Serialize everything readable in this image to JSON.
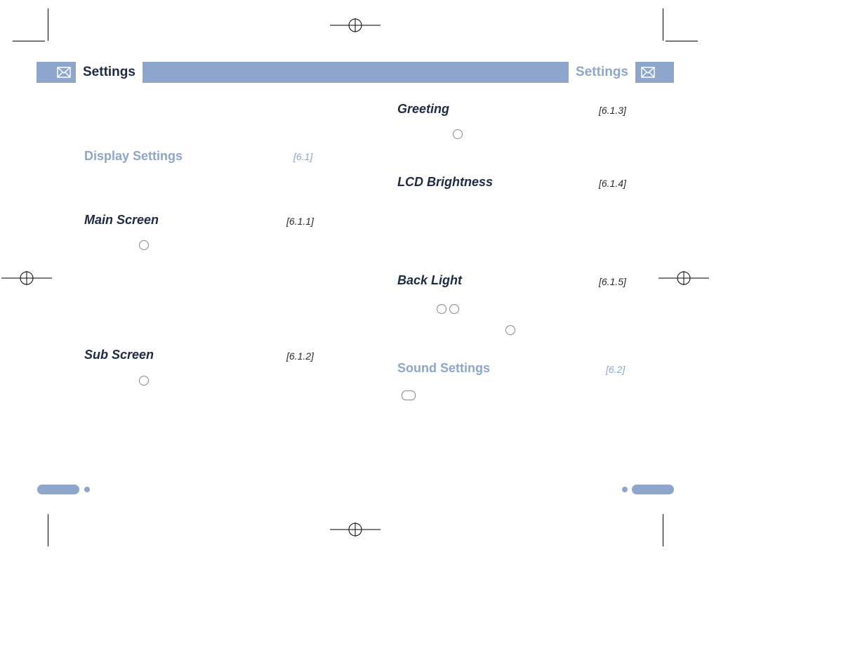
{
  "header": {
    "left_tab": "Settings",
    "right_tab": "Settings"
  },
  "left_column": {
    "section_title": "Display Settings",
    "section_ref": "[6.1]",
    "items": [
      {
        "title": "Main Screen",
        "ref": "[6.1.1]"
      },
      {
        "title": "Sub Screen",
        "ref": "[6.1.2]"
      }
    ]
  },
  "right_column": {
    "items": [
      {
        "title": "Greeting",
        "ref": "[6.1.3]"
      },
      {
        "title": "LCD Brightness",
        "ref": "[6.1.4]"
      },
      {
        "title": "Back Light",
        "ref": "[6.1.5]"
      }
    ],
    "section_title": "Sound Settings",
    "section_ref": "[6.2]"
  }
}
